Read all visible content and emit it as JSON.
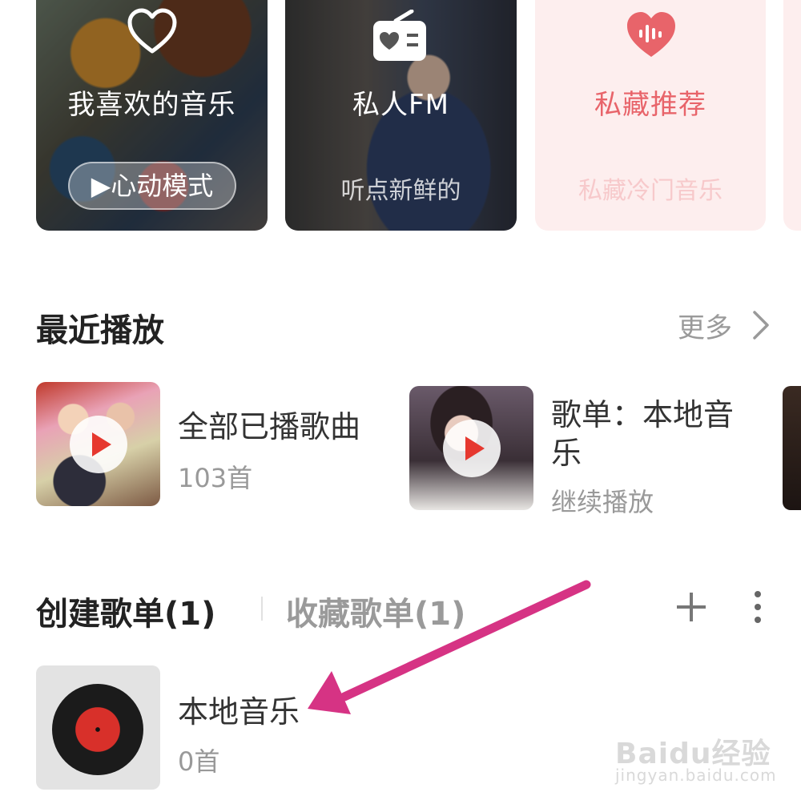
{
  "top_cards": {
    "favorites": {
      "title": "我喜欢的音乐",
      "mode_button": "▶心动模式",
      "icon": "heart-outline-icon"
    },
    "personal_fm": {
      "title": "私人FM",
      "subtitle": "听点新鲜的",
      "icon": "radio-icon"
    },
    "private_picks": {
      "title": "私藏推荐",
      "subtitle": "私藏冷门音乐",
      "icon": "heart-soundwave-icon",
      "accent": "#e8646a"
    }
  },
  "recent": {
    "title": "最近播放",
    "more_label": "更多",
    "items": [
      {
        "title": "全部已播歌曲",
        "subtitle": "103首"
      },
      {
        "title_line1": "歌单：本地音",
        "title_line2": "乐",
        "subtitle": "继续播放"
      }
    ]
  },
  "playlists": {
    "tab_created": "创建歌单(1)",
    "tab_collected": "收藏歌单(1)",
    "items": [
      {
        "title": "本地音乐",
        "subtitle": "0首"
      }
    ]
  },
  "annotation": {
    "arrow_color": "#d63384"
  },
  "watermark": {
    "logo": "Baidu经验",
    "url": "jingyan.baidu.com"
  }
}
